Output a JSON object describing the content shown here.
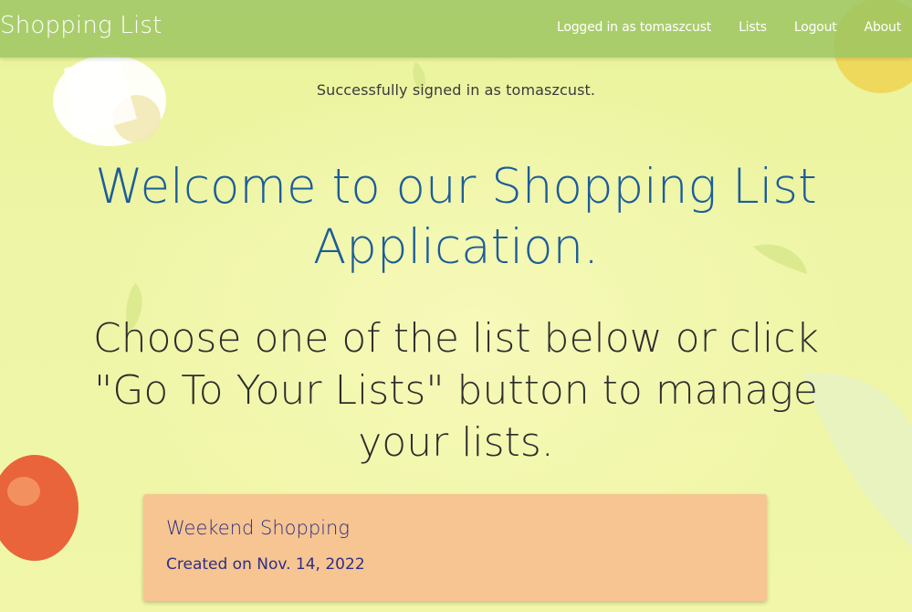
{
  "navbar": {
    "brand": "Shopping List",
    "links": [
      {
        "label": "Logged in as tomaszcust"
      },
      {
        "label": "Lists"
      },
      {
        "label": "Logout"
      },
      {
        "label": "About"
      }
    ]
  },
  "flash": {
    "message": "Successfully signed in as tomaszcust."
  },
  "main": {
    "welcome": "Welcome to our Shopping List Application.",
    "instructions": "Choose one of the list below or click \"Go To Your Lists\" button to manage your lists."
  },
  "lists": [
    {
      "name": "Weekend Shopping",
      "created": "Created on Nov. 14, 2022"
    }
  ],
  "colors": {
    "navbar": "#9bc462",
    "welcome_text": "#1c5d98",
    "card": "#f6c592",
    "card_text": "#2e2f82"
  }
}
